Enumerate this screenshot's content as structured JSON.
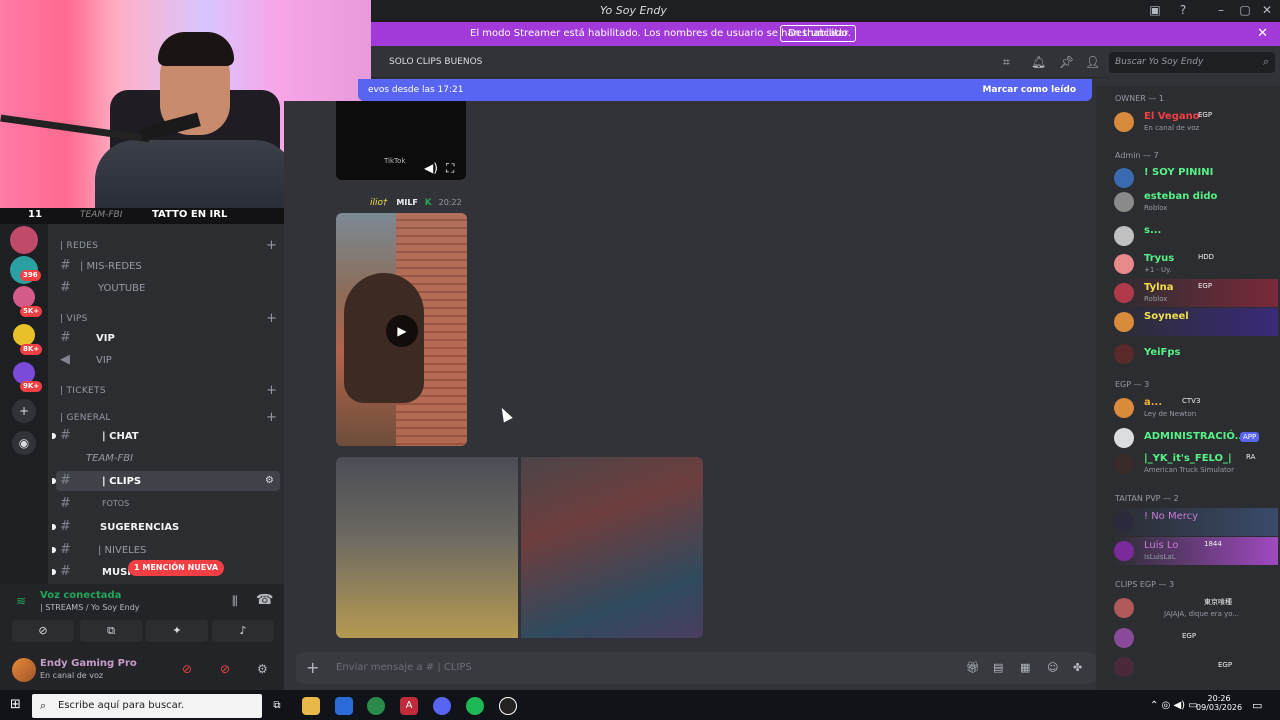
{
  "window": {
    "title": "Yo Soy Endy",
    "icons": [
      "monitor-icon",
      "help-icon",
      "minimize-icon",
      "maximize-icon",
      "close-icon"
    ]
  },
  "banner": {
    "text": "El modo Streamer está habilitado. Los nombres de usuario se han truncado.",
    "button": "Deshabilitar",
    "close": "✕"
  },
  "stream": {
    "count_left": "11",
    "team": "TEAM-FBI",
    "title": "TATTO EN IRL",
    "count_right": "50"
  },
  "server_rail": {
    "badges": [
      "396",
      "5K+",
      "8K+",
      "9K+"
    ]
  },
  "channels": {
    "categories": {
      "redes": "| REDES",
      "vips": "| VIPS",
      "tickets": "| TICKETS",
      "general": "| GENERAL"
    },
    "items": {
      "mis_redes": "| MIS-REDES",
      "youtube": "YOUTUBE",
      "vip1": "VIP",
      "vip2": "VIP",
      "chat": "| CHAT",
      "team_fbi": "TEAM-FBI",
      "clips": "| CLIPS",
      "fotos": "FOTOS",
      "sugerencias": "SUGERENCIAS",
      "niveles": "| NIVELES",
      "musica": "MUSI"
    },
    "mention_pill": "1 MENCIÓN NUEVA"
  },
  "voice": {
    "status": "Voz conectada",
    "channel": "| STREAMS / Yo Soy Endy"
  },
  "user": {
    "name": "Endy Gaming Pro",
    "status": "En canal de voz"
  },
  "header": {
    "channel": "SOLO CLIPS BUENOS",
    "search_placeholder": "Buscar Yo Soy Endy"
  },
  "new_messages": {
    "text": "evos desde las 17:21",
    "action": "Marcar como leído"
  },
  "message": {
    "tiktok_label": "TikTok",
    "author": "ilio†",
    "role": "MILF",
    "time": "20:22"
  },
  "composer": {
    "placeholder": "Enviar mensaje a #",
    "channel": "| CLIPS"
  },
  "members": {
    "groups": [
      {
        "title": "OWNER — 1"
      },
      {
        "title": "Admin — 7"
      },
      {
        "title": "EGP — 3"
      },
      {
        "title": "TAITAN PVP — 2"
      },
      {
        "title": "CLIPS EGP — 3"
      }
    ],
    "rows": [
      {
        "name": "El Vegano",
        "tag": "EGP",
        "status": "En canal de voz",
        "color": "#f23f43"
      },
      {
        "name": "! SOY PININI",
        "tag": "",
        "status": "",
        "color": "#57f287"
      },
      {
        "name": "esteban dido",
        "tag": "",
        "status": "Roblox",
        "color": "#57f287"
      },
      {
        "name": "s...",
        "tag": "",
        "status": "",
        "color": "#57f287"
      },
      {
        "name": "Tryus",
        "tag": "HDD",
        "status": "+1 · Uy.",
        "color": "#57f287"
      },
      {
        "name": "Tylna",
        "tag": "EGP",
        "status": "Roblox",
        "color": "#57f287"
      },
      {
        "name": "Soyneel",
        "tag": "",
        "status": "",
        "color": "#57f287"
      },
      {
        "name": "YeiFps",
        "tag": "",
        "status": "",
        "color": "#57f287"
      },
      {
        "name": "a...",
        "tag": "CTV3",
        "status": "Ley de Newton",
        "color": "#f0b232"
      },
      {
        "name": "ADMINISTRACIÓ...",
        "tag": "APP",
        "status": "",
        "color": "#57f287"
      },
      {
        "name": "|_YK_it's_FELO_|",
        "tag": "RA",
        "status": "American Truck Simulator",
        "color": "#57f287"
      },
      {
        "name": "! No Mercy",
        "tag": "",
        "status": "",
        "color": "#c77bd9"
      },
      {
        "name": "Luis Lo",
        "tag": "1844",
        "status": "IsLuisLaL",
        "color": "#c77bd9"
      },
      {
        "name": "",
        "tag": "東京喰種",
        "status": "JAJAJA, dique era yo...",
        "color": "#5865f2"
      },
      {
        "name": "",
        "tag": "EGP",
        "status": "",
        "color": "#5865f2"
      },
      {
        "name": "",
        "tag": "EGP",
        "status": "",
        "color": "#5865f2"
      }
    ]
  },
  "taskbar": {
    "search_placeholder": "Escribe aquí para buscar.",
    "time": "20:26",
    "date": "09/03/2026"
  }
}
